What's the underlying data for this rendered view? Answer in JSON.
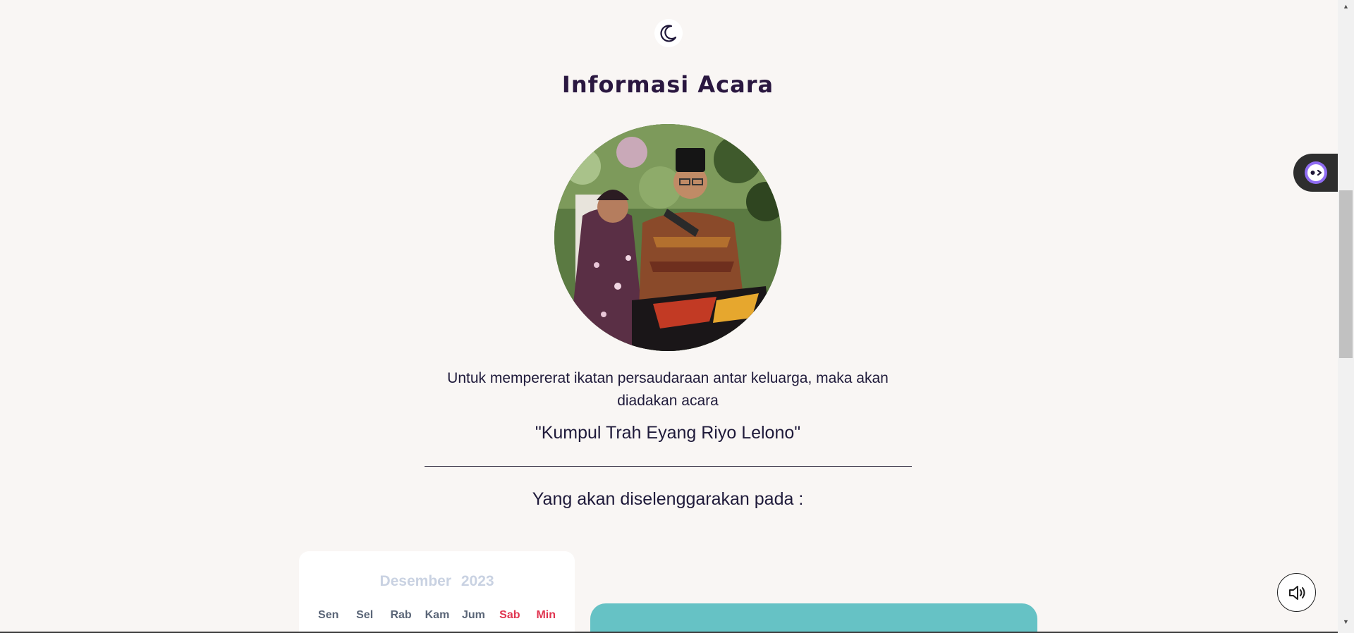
{
  "header": {
    "theme_toggle_icon": "moon-icon"
  },
  "main": {
    "title": "Informasi Acara",
    "photo_icon": "couple-photo",
    "intro_text": "Untuk mempererat ikatan persaudaraan antar keluarga, maka akan diadakan acara",
    "event_name": "\"Kumpul Trah Eyang Riyo Lelono\"",
    "schedule_lead": "Yang akan diselenggarakan pada :"
  },
  "calendar": {
    "month": "Desember",
    "year": "2023",
    "days": [
      "Sen",
      "Sel",
      "Rab",
      "Kam",
      "Jum",
      "Sab",
      "Min"
    ],
    "weekend_color": "#e0344f"
  },
  "colors": {
    "background": "#f9f6f4",
    "accent_card": "#66c2c5",
    "title": "#2a1740"
  },
  "widgets": {
    "assistant_icon": "assistant-bot-icon",
    "audio_icon": "speaker-icon"
  }
}
